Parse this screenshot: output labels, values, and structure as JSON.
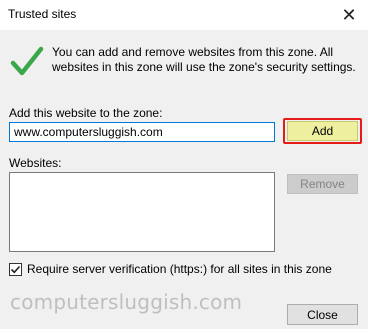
{
  "window": {
    "title": "Trusted sites",
    "close_glyph": "✕"
  },
  "info": {
    "icon": "checkmark-icon",
    "text": "You can add and remove websites from this zone. All websites in this zone will use the zone's security settings."
  },
  "add_site": {
    "label": "Add this website to the zone:",
    "value": "www.computersluggish.com",
    "add_label": "Add"
  },
  "websites": {
    "label": "Websites:",
    "items": [],
    "remove_label": "Remove"
  },
  "verification": {
    "label": "Require server verification (https:) for all sites in this zone",
    "checked": true
  },
  "watermark": "computersluggish.com",
  "footer": {
    "close_label": "Close"
  },
  "colors": {
    "accent": "#0078d7",
    "check_green": "#3aa84a",
    "highlight_fill": "#eef0a0",
    "highlight_border": "#e41b17"
  }
}
